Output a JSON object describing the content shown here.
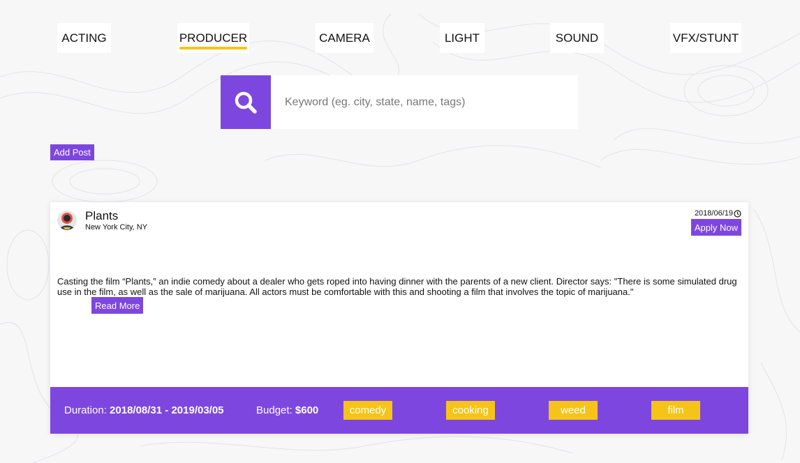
{
  "categories": [
    {
      "label": "ACTING",
      "active": false
    },
    {
      "label": "PRODUCER",
      "active": true
    },
    {
      "label": "CAMERA",
      "active": false
    },
    {
      "label": "LIGHT",
      "active": false
    },
    {
      "label": "SOUND",
      "active": false
    },
    {
      "label": "VFX/STUNT",
      "active": false
    }
  ],
  "search": {
    "placeholder": "Keyword (eg. city, state, name, tags)",
    "value": "",
    "icon": "search-icon"
  },
  "actions": {
    "add_post_label": "Add Post"
  },
  "post": {
    "title": "Plants",
    "location": "New York City, NY",
    "date": "2018/06/19",
    "date_icon": "clock-icon",
    "apply_label": "Apply Now",
    "description": "Casting the film “Plants,” an indie comedy about a dealer who gets roped into having dinner with the parents of a new client. Director says: \"There is some simulated drug use in the film, as well as the sale of marijuana. All actors must be comfortable with this and shooting a film that involves the topic of marijuana.\"",
    "read_more_label": "Read More",
    "duration_label": "Duration:",
    "duration_value": "2018/08/31 - 2019/03/05",
    "budget_label": "Budget:",
    "budget_value": "$600",
    "tags": [
      "comedy",
      "cooking",
      "weed",
      "film"
    ]
  },
  "colors": {
    "accent": "#7d47df",
    "tag": "#f6c418",
    "underline": "#f6c418",
    "background": "#f7f7f8"
  }
}
